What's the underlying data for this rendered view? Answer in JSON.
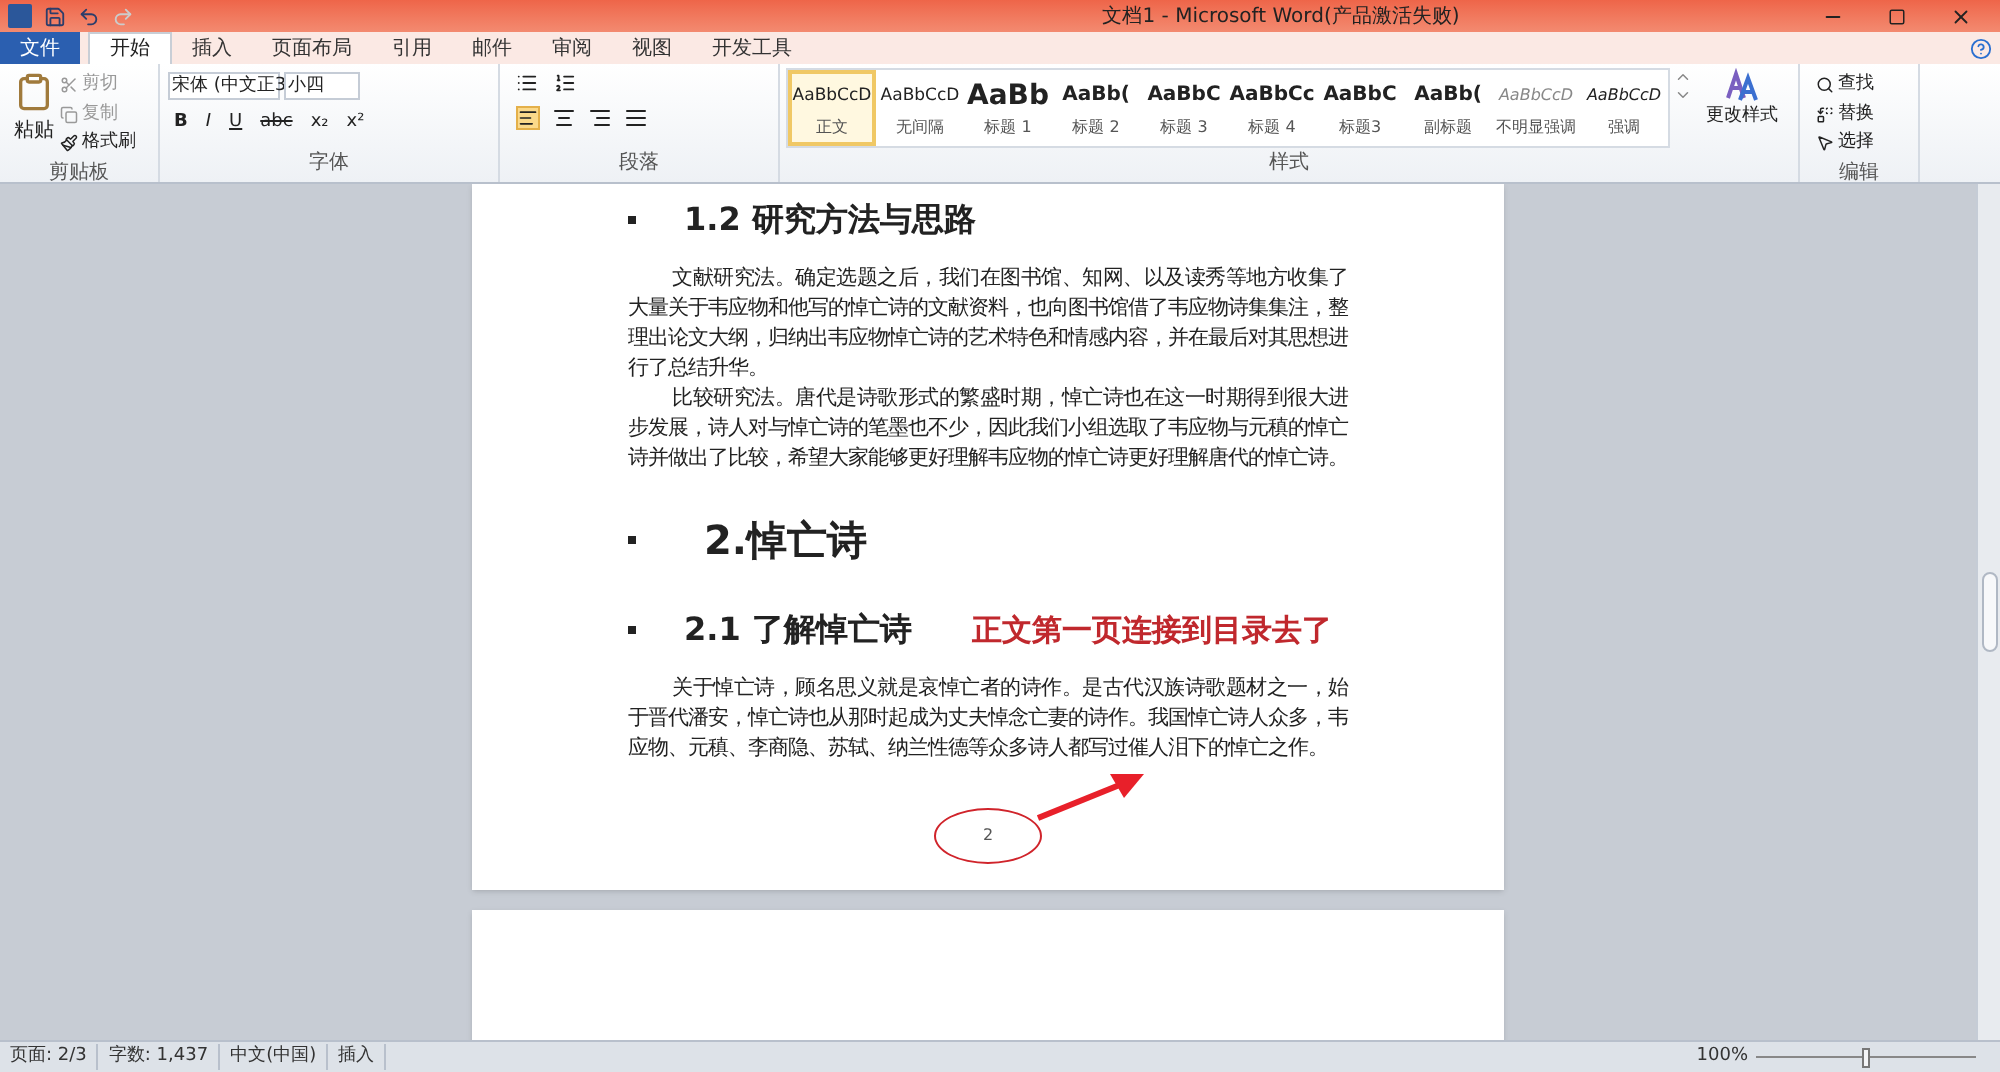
{
  "window": {
    "title": "文档1 - Microsoft Word(产品激活失败)"
  },
  "tabs": [
    {
      "label": "文件",
      "kind": "file",
      "selected": false
    },
    {
      "label": "开始",
      "kind": "tab",
      "selected": true
    },
    {
      "label": "插入",
      "kind": "tab",
      "selected": false
    },
    {
      "label": "页面布局",
      "kind": "tab",
      "selected": false
    },
    {
      "label": "引用",
      "kind": "tab",
      "selected": false
    },
    {
      "label": "邮件",
      "kind": "tab",
      "selected": false
    },
    {
      "label": "审阅",
      "kind": "tab",
      "selected": false
    },
    {
      "label": "视图",
      "kind": "tab",
      "selected": false
    },
    {
      "label": "开发工具",
      "kind": "tab",
      "selected": false
    }
  ],
  "clipboard": {
    "label": "剪贴板",
    "paste": "粘贴",
    "items": [
      "剪切",
      "复制",
      "格式刷"
    ]
  },
  "font": {
    "label": "字体",
    "font_name": "宋体 (中文正3",
    "font_size": "小四",
    "format_buttons": [
      "B",
      "I",
      "U",
      "abc",
      "x₂",
      "x²"
    ]
  },
  "paragraph": {
    "label": "段落"
  },
  "styles": {
    "label": "样式",
    "items": [
      {
        "preview": "AaBbCcD",
        "name": "正文",
        "kind": "normal",
        "selected": true
      },
      {
        "preview": "AaBbCcD",
        "name": "无间隔",
        "kind": "normal",
        "selected": false
      },
      {
        "preview": "AaBb",
        "name": "标题 1",
        "kind": "title",
        "selected": false
      },
      {
        "preview": "AaBb(",
        "name": "标题 2",
        "kind": "heading",
        "selected": false
      },
      {
        "preview": "AaBbC",
        "name": "标题 3",
        "kind": "heading",
        "selected": false
      },
      {
        "preview": "AaBbCc",
        "name": "标题 4",
        "kind": "heading",
        "selected": false
      },
      {
        "preview": "AaBbC",
        "name": "标题3",
        "kind": "heading",
        "selected": false
      },
      {
        "preview": "AaBb(",
        "name": "副标题",
        "kind": "heading",
        "selected": false
      },
      {
        "preview": "AaBbCcD",
        "name": "不明显强调",
        "kind": "subtle",
        "selected": false
      },
      {
        "preview": "AaBbCcD",
        "name": "强调",
        "kind": "emphasis",
        "selected": false
      }
    ],
    "change_styles": "更改样式"
  },
  "editing": {
    "label": "编辑",
    "items": [
      "查找",
      "替换",
      "选择"
    ]
  },
  "document": {
    "blocks": [
      {
        "kind": "heading2",
        "text": "1.2 研究方法与思路"
      },
      {
        "kind": "para",
        "text": "文献研究法。确定选题之后，我们在图书馆、知网、以及读秀等地方收集了大量关于韦应物和他写的悼亡诗的文献资料，也向图书馆借了韦应物诗集集注，整理出论文大纲，归纳出韦应物悼亡诗的艺术特色和情感内容，并在最后对其思想进行了总结升华。"
      },
      {
        "kind": "para",
        "text": "比较研究法。唐代是诗歌形式的繁盛时期，悼亡诗也在这一时期得到很大进步发展，诗人对与悼亡诗的笔墨也不少，因此我们小组选取了韦应物与元稹的悼亡诗并做出了比较，希望大家能够更好理解韦应物的悼亡诗更好理解唐代的悼亡诗。"
      },
      {
        "kind": "heading1",
        "text": "2.悼亡诗"
      },
      {
        "kind": "heading2",
        "text": "2.1 了解悼亡诗",
        "note": "正文第一页连接到目录去了"
      },
      {
        "kind": "para",
        "text": "关于悼亡诗，顾名思义就是哀悼亡者的诗作。是古代汉族诗歌题材之一，始于晋代潘安，悼亡诗也从那时起成为丈夫悼念亡妻的诗作。我国悼亡诗人众多，韦应物、元稹、李商隐、苏轼、纳兰性德等众多诗人都写过催人泪下的悼亡之作。"
      }
    ],
    "page_number": "2"
  },
  "status_bar": {
    "items": [
      "页面: 2/3",
      "字数: 1,437",
      "中文(中国)",
      "插入"
    ],
    "zoom": "100%",
    "zoom_slider": {
      "level": 0.5
    }
  }
}
